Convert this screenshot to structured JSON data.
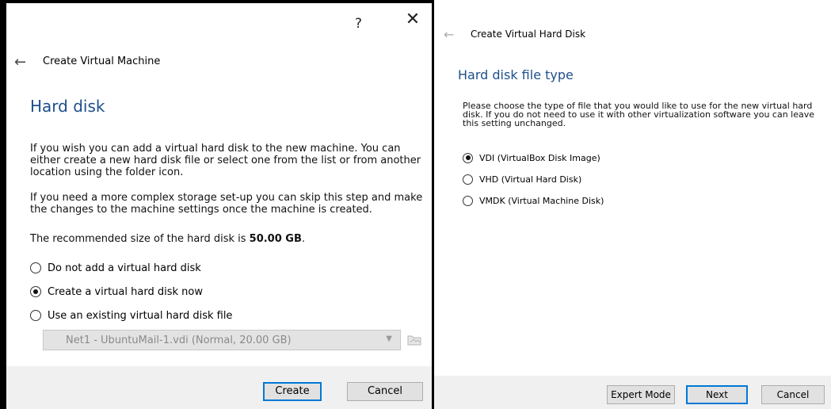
{
  "left_dialog": {
    "title_bar": {
      "help": "?",
      "close": "✕"
    },
    "nav_title": "Create Virtual Machine",
    "section_title": "Hard disk",
    "paragraph1": "If you wish you can add a virtual hard disk to the new machine. You can either create a new hard disk file or select one from the list or from another location using the folder icon.",
    "paragraph2": "If you need a more complex storage set-up you can skip this step and make the changes to the machine settings once the machine is created.",
    "recommended_prefix": "The recommended size of the hard disk is ",
    "recommended_size": "50.00 GB",
    "recommended_suffix": ".",
    "options": [
      {
        "label": "Do not add a virtual hard disk",
        "selected": false
      },
      {
        "label": "Create a virtual hard disk now",
        "selected": true
      },
      {
        "label": "Use an existing virtual hard disk file",
        "selected": false
      }
    ],
    "existing_disk_combo": {
      "value": "Net1 - UbuntuMail-1.vdi (Normal, 20.00 GB)",
      "enabled": false
    },
    "buttons": {
      "create": "Create",
      "cancel": "Cancel"
    }
  },
  "right_dialog": {
    "nav_title": "Create Virtual Hard Disk",
    "section_title": "Hard disk file type",
    "description": "Please choose the type of file that you would like to use for the new virtual hard disk. If you do not need to use it with other virtualization software you can leave this setting unchanged.",
    "options": [
      {
        "label": "VDI (VirtualBox Disk Image)",
        "selected": true
      },
      {
        "label": "VHD (Virtual Hard Disk)",
        "selected": false
      },
      {
        "label": "VMDK (Virtual Machine Disk)",
        "selected": false
      }
    ],
    "buttons": {
      "expert": "Expert Mode",
      "next": "Next",
      "cancel": "Cancel"
    }
  },
  "colors": {
    "accent": "#0078d7",
    "heading": "#1e4f8c",
    "button_bar": "#f0f0f0"
  },
  "icons": [
    "help-icon",
    "close-icon",
    "back-arrow-icon",
    "combo-arrow-icon",
    "folder-icon"
  ]
}
